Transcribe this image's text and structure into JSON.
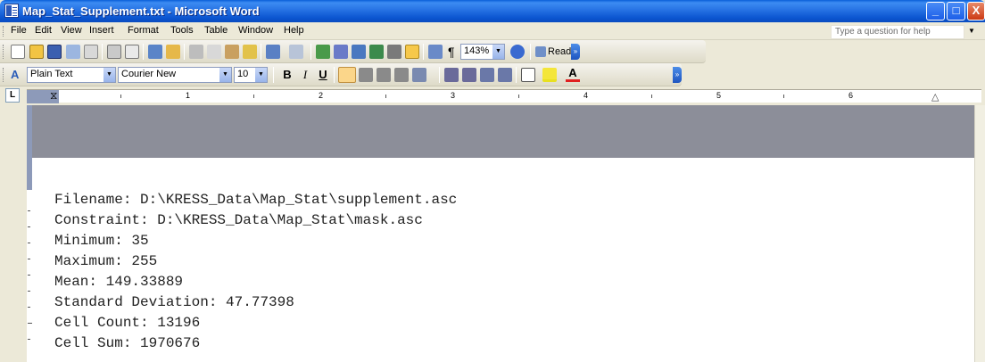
{
  "window": {
    "title": "Map_Stat_Supplement.txt - Microsoft Word",
    "minimize_glyph": "_",
    "maximize_glyph": "□",
    "close_glyph": "X"
  },
  "menu": {
    "items": [
      "File",
      "Edit",
      "View",
      "Insert",
      "Format",
      "Tools",
      "Table",
      "Window",
      "Help"
    ],
    "help_placeholder": "Type a question for help"
  },
  "standard_toolbar": {
    "zoom": "143%",
    "read_label": "Read"
  },
  "formatting_toolbar": {
    "style": "Plain Text",
    "font": "Courier New",
    "font_size": "10",
    "bold": "B",
    "italic": "I",
    "underline": "U",
    "font_color_glyph": "A"
  },
  "ruler": {
    "corner_glyph": "L",
    "numbers": [
      "1",
      "2",
      "3",
      "4",
      "5",
      "6"
    ]
  },
  "document": {
    "lines": [
      "Filename: D:\\KRESS_Data\\Map_Stat\\supplement.asc",
      "Constraint: D:\\KRESS_Data\\Map_Stat\\mask.asc",
      "Minimum: 35",
      "Maximum: 255",
      "Mean: 149.33889",
      "Standard Deviation: 47.77398",
      "Cell Count: 13196",
      "Cell Sum: 1970676"
    ]
  }
}
